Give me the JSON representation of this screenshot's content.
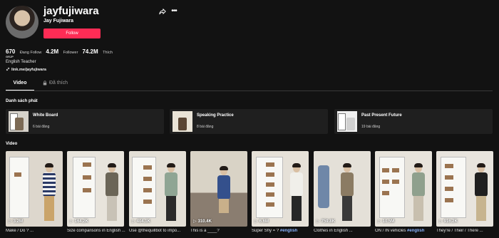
{
  "profile": {
    "username": "jayfujiwara",
    "display_name": "Jay Fujiwara",
    "follow_label": "Follow",
    "stats": [
      {
        "value": "670",
        "label": "Đang Follow"
      },
      {
        "value": "4.2M",
        "label": "Follower"
      },
      {
        "value": "74.2M",
        "label": "Thích"
      }
    ],
    "small_label": "GRJP",
    "bio": "English Teacher",
    "link": "link.me/jayfujiwara"
  },
  "tabs": {
    "video": "Video",
    "liked": "Đã thích"
  },
  "playlists": {
    "title": "Danh sách phát",
    "items": [
      {
        "title": "White Board",
        "count": "6 bài đăng"
      },
      {
        "title": "Speaking Practice",
        "count": "8 bài đăng"
      },
      {
        "title": "Past Present Future",
        "count": "19 bài đăng"
      }
    ]
  },
  "videos": {
    "title": "Video",
    "items": [
      {
        "views": "3.2M",
        "caption": "Make / Do ? ..."
      },
      {
        "views": "164.2K",
        "caption": "Size comparisons in English ..."
      },
      {
        "views": "404.1K",
        "caption": "Use @thequillbot to impo..."
      },
      {
        "views": "310.4K",
        "caption": "This is a ____?"
      },
      {
        "views": "6.6M",
        "caption": "Super Shy = ? ",
        "hashtag": "#english"
      },
      {
        "views": "759.8K",
        "caption": "Clothes in English ..."
      },
      {
        "views": "10.5M",
        "caption": "ON / IN vehicles ",
        "hashtag": "#english"
      },
      {
        "views": "916.2K",
        "caption": "They're / Their / There ..."
      }
    ]
  },
  "colors": {
    "background": "#121212",
    "accent": "#fe2c55",
    "card": "#1f1f1f"
  }
}
